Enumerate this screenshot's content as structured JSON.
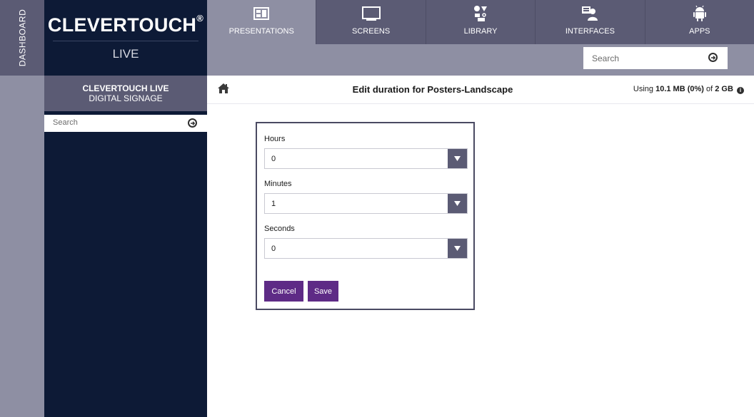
{
  "dashboard_tab": "DASHBOARD",
  "brand": {
    "title": "CLEVERTOUCH",
    "mark": "®",
    "subtitle": "LIVE"
  },
  "sidebar": {
    "heading_line1": "CLEVERTOUCH LIVE",
    "heading_line2": "DIGITAL SIGNAGE",
    "search_placeholder": "Search"
  },
  "topnav": {
    "items": [
      {
        "label": "PRESENTATIONS",
        "icon": "presentations-icon",
        "active": true
      },
      {
        "label": "SCREENS",
        "icon": "monitor-icon",
        "active": false
      },
      {
        "label": "LIBRARY",
        "icon": "library-icon",
        "active": false
      },
      {
        "label": "INTERFACES",
        "icon": "interfaces-icon",
        "active": false
      },
      {
        "label": "APPS",
        "icon": "android-icon",
        "active": false
      }
    ],
    "search_placeholder": "Search"
  },
  "content": {
    "title": "Edit duration for Posters-Landscape",
    "usage_prefix": "Using ",
    "usage_amount": "10.1 MB (0%)",
    "usage_mid": " of ",
    "usage_total": "2 GB"
  },
  "dialog": {
    "hours_label": "Hours",
    "hours_value": "0",
    "minutes_label": "Minutes",
    "minutes_value": "1",
    "seconds_label": "Seconds",
    "seconds_value": "0",
    "cancel_label": "Cancel",
    "save_label": "Save"
  },
  "colors": {
    "nav_dark": "#5b5b74",
    "nav_light": "#8e8fa3",
    "sidebar_navy": "#0d1a36",
    "button_purple": "#5e2b86"
  }
}
